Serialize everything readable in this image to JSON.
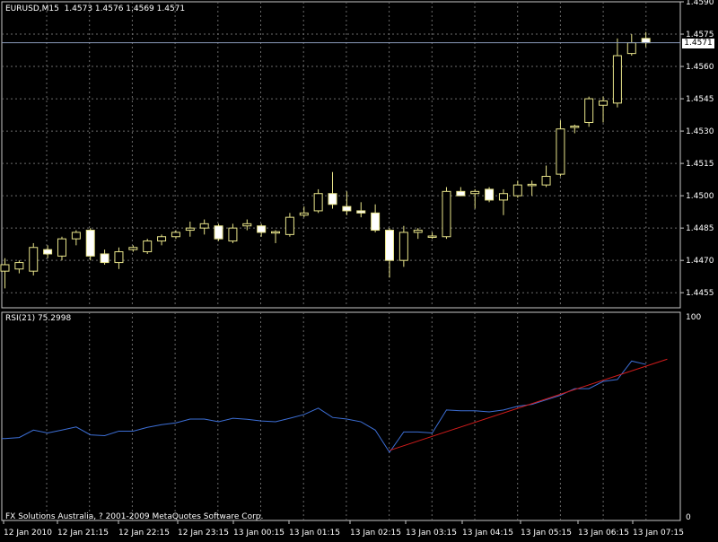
{
  "header": {
    "symbol": "EURUSD,M15",
    "ohlc": "1.4573 1.4576 1.4569 1.4571",
    "current_price_tag": "1.4571"
  },
  "rsi_panel": {
    "label": "RSI(21) 75.2998",
    "max_label": "100",
    "min_label": "0"
  },
  "copyright": "FX Solutions Australia, ? 2001-2009 MetaQuotes Software Corp.",
  "colors": {
    "background": "#000000",
    "grid": "#6b6b6b",
    "bull_candle": "#ffffff",
    "bear_candle": "#000000",
    "candle_outline": "#e8e48a",
    "rsi_line": "#3d6fd6",
    "trendline": "#d21c1c",
    "bid_line": "#8898b8",
    "text": "#ffffff"
  },
  "chart_data": [
    {
      "type": "candlestick",
      "title": "EURUSD,M15",
      "ylim": [
        1.4448,
        1.459
      ],
      "y_ticks": [
        "1.4590",
        "1.4575",
        "1.4560",
        "1.4545",
        "1.4530",
        "1.4515",
        "1.4500",
        "1.4485",
        "1.4470",
        "1.4455"
      ],
      "x_ticks": [
        "12 Jan 2010",
        "12 Jan 21:15",
        "12 Jan 22:15",
        "12 Jan 23:15",
        "13 Jan 00:15",
        "13 Jan 01:15",
        "13 Jan 02:15",
        "13 Jan 03:15",
        "13 Jan 04:15",
        "13 Jan 05:15",
        "13 Jan 06:15",
        "13 Jan 07:15"
      ],
      "current_price": 1.4571,
      "grid": true,
      "candles": [
        {
          "o": 1.4465,
          "h": 1.4471,
          "l": 1.4457,
          "c": 1.4468
        },
        {
          "o": 1.4466,
          "h": 1.447,
          "l": 1.4464,
          "c": 1.4469
        },
        {
          "o": 1.4465,
          "h": 1.4478,
          "l": 1.4463,
          "c": 1.4476
        },
        {
          "o": 1.4475,
          "h": 1.4477,
          "l": 1.4471,
          "c": 1.4473
        },
        {
          "o": 1.4472,
          "h": 1.4481,
          "l": 1.447,
          "c": 1.448
        },
        {
          "o": 1.448,
          "h": 1.4484,
          "l": 1.4477,
          "c": 1.4483
        },
        {
          "o": 1.4484,
          "h": 1.4485,
          "l": 1.447,
          "c": 1.4472
        },
        {
          "o": 1.4473,
          "h": 1.4475,
          "l": 1.4468,
          "c": 1.4469
        },
        {
          "o": 1.4469,
          "h": 1.4476,
          "l": 1.4466,
          "c": 1.4474
        },
        {
          "o": 1.4475,
          "h": 1.4477,
          "l": 1.4474,
          "c": 1.4476
        },
        {
          "o": 1.4474,
          "h": 1.448,
          "l": 1.4473,
          "c": 1.4479
        },
        {
          "o": 1.4479,
          "h": 1.4482,
          "l": 1.4477,
          "c": 1.4481
        },
        {
          "o": 1.4481,
          "h": 1.4484,
          "l": 1.448,
          "c": 1.4483
        },
        {
          "o": 1.4484,
          "h": 1.4488,
          "l": 1.4481,
          "c": 1.4485
        },
        {
          "o": 1.4485,
          "h": 1.4489,
          "l": 1.4482,
          "c": 1.4487
        },
        {
          "o": 1.4486,
          "h": 1.4487,
          "l": 1.4479,
          "c": 1.448
        },
        {
          "o": 1.4479,
          "h": 1.4487,
          "l": 1.4478,
          "c": 1.4485
        },
        {
          "o": 1.4486,
          "h": 1.4489,
          "l": 1.4484,
          "c": 1.4487
        },
        {
          "o": 1.4486,
          "h": 1.4487,
          "l": 1.4481,
          "c": 1.4483
        },
        {
          "o": 1.4483,
          "h": 1.4484,
          "l": 1.4478,
          "c": 1.4483
        },
        {
          "o": 1.4482,
          "h": 1.4492,
          "l": 1.4481,
          "c": 1.449
        },
        {
          "o": 1.4491,
          "h": 1.4495,
          "l": 1.449,
          "c": 1.4492
        },
        {
          "o": 1.4493,
          "h": 1.4503,
          "l": 1.4492,
          "c": 1.4501
        },
        {
          "o": 1.4501,
          "h": 1.4511,
          "l": 1.4494,
          "c": 1.4496
        },
        {
          "o": 1.4495,
          "h": 1.4502,
          "l": 1.4491,
          "c": 1.4493
        },
        {
          "o": 1.4493,
          "h": 1.4497,
          "l": 1.449,
          "c": 1.4492
        },
        {
          "o": 1.4492,
          "h": 1.4496,
          "l": 1.4483,
          "c": 1.4484
        },
        {
          "o": 1.4484,
          "h": 1.4485,
          "l": 1.4462,
          "c": 1.447
        },
        {
          "o": 1.447,
          "h": 1.4486,
          "l": 1.4467,
          "c": 1.4483
        },
        {
          "o": 1.4483,
          "h": 1.4485,
          "l": 1.448,
          "c": 1.4484
        },
        {
          "o": 1.4481,
          "h": 1.4483,
          "l": 1.448,
          "c": 1.4481
        },
        {
          "o": 1.4481,
          "h": 1.4504,
          "l": 1.448,
          "c": 1.4502
        },
        {
          "o": 1.4502,
          "h": 1.4504,
          "l": 1.45,
          "c": 1.45
        },
        {
          "o": 1.4501,
          "h": 1.4503,
          "l": 1.4494,
          "c": 1.4502
        },
        {
          "o": 1.4503,
          "h": 1.4504,
          "l": 1.4497,
          "c": 1.4498
        },
        {
          "o": 1.4498,
          "h": 1.4503,
          "l": 1.4491,
          "c": 1.4501
        },
        {
          "o": 1.45,
          "h": 1.4507,
          "l": 1.4499,
          "c": 1.4505
        },
        {
          "o": 1.4505,
          "h": 1.4507,
          "l": 1.45,
          "c": 1.4505
        },
        {
          "o": 1.4505,
          "h": 1.4514,
          "l": 1.4504,
          "c": 1.4509
        },
        {
          "o": 1.451,
          "h": 1.4535,
          "l": 1.4509,
          "c": 1.4531
        },
        {
          "o": 1.4532,
          "h": 1.4533,
          "l": 1.4529,
          "c": 1.4532
        },
        {
          "o": 1.4534,
          "h": 1.4546,
          "l": 1.4532,
          "c": 1.4545
        },
        {
          "o": 1.4542,
          "h": 1.4546,
          "l": 1.4534,
          "c": 1.4544
        },
        {
          "o": 1.4543,
          "h": 1.4573,
          "l": 1.4541,
          "c": 1.4565
        },
        {
          "o": 1.4566,
          "h": 1.4575,
          "l": 1.4565,
          "c": 1.4571
        },
        {
          "o": 1.4573,
          "h": 1.4576,
          "l": 1.4569,
          "c": 1.4571
        }
      ]
    },
    {
      "type": "line",
      "title": "RSI(21) 75.2998",
      "ylim": [
        0,
        100
      ],
      "y_ticks": [
        "100",
        "0"
      ],
      "series": [
        {
          "name": "RSI(21)",
          "values": [
            39.5,
            40.0,
            43.6,
            42.2,
            43.6,
            45.1,
            41.3,
            40.9,
            43.1,
            43.1,
            44.9,
            46.2,
            47.1,
            48.9,
            48.9,
            47.6,
            49.3,
            48.8,
            48.0,
            47.6,
            49.3,
            51.1,
            54.2,
            49.7,
            48.9,
            47.6,
            43.6,
            32.9,
            42.7,
            42.7,
            42.2,
            53.3,
            52.9,
            52.9,
            52.4,
            53.3,
            55.1,
            56.0,
            58.2,
            60.4,
            63.6,
            63.6,
            67.1,
            68.0,
            76.9,
            75.3
          ]
        }
      ],
      "trendline": {
        "from_index": 27,
        "from_value": 33.8,
        "to_index": 46.5,
        "to_value": 77.8
      }
    }
  ]
}
